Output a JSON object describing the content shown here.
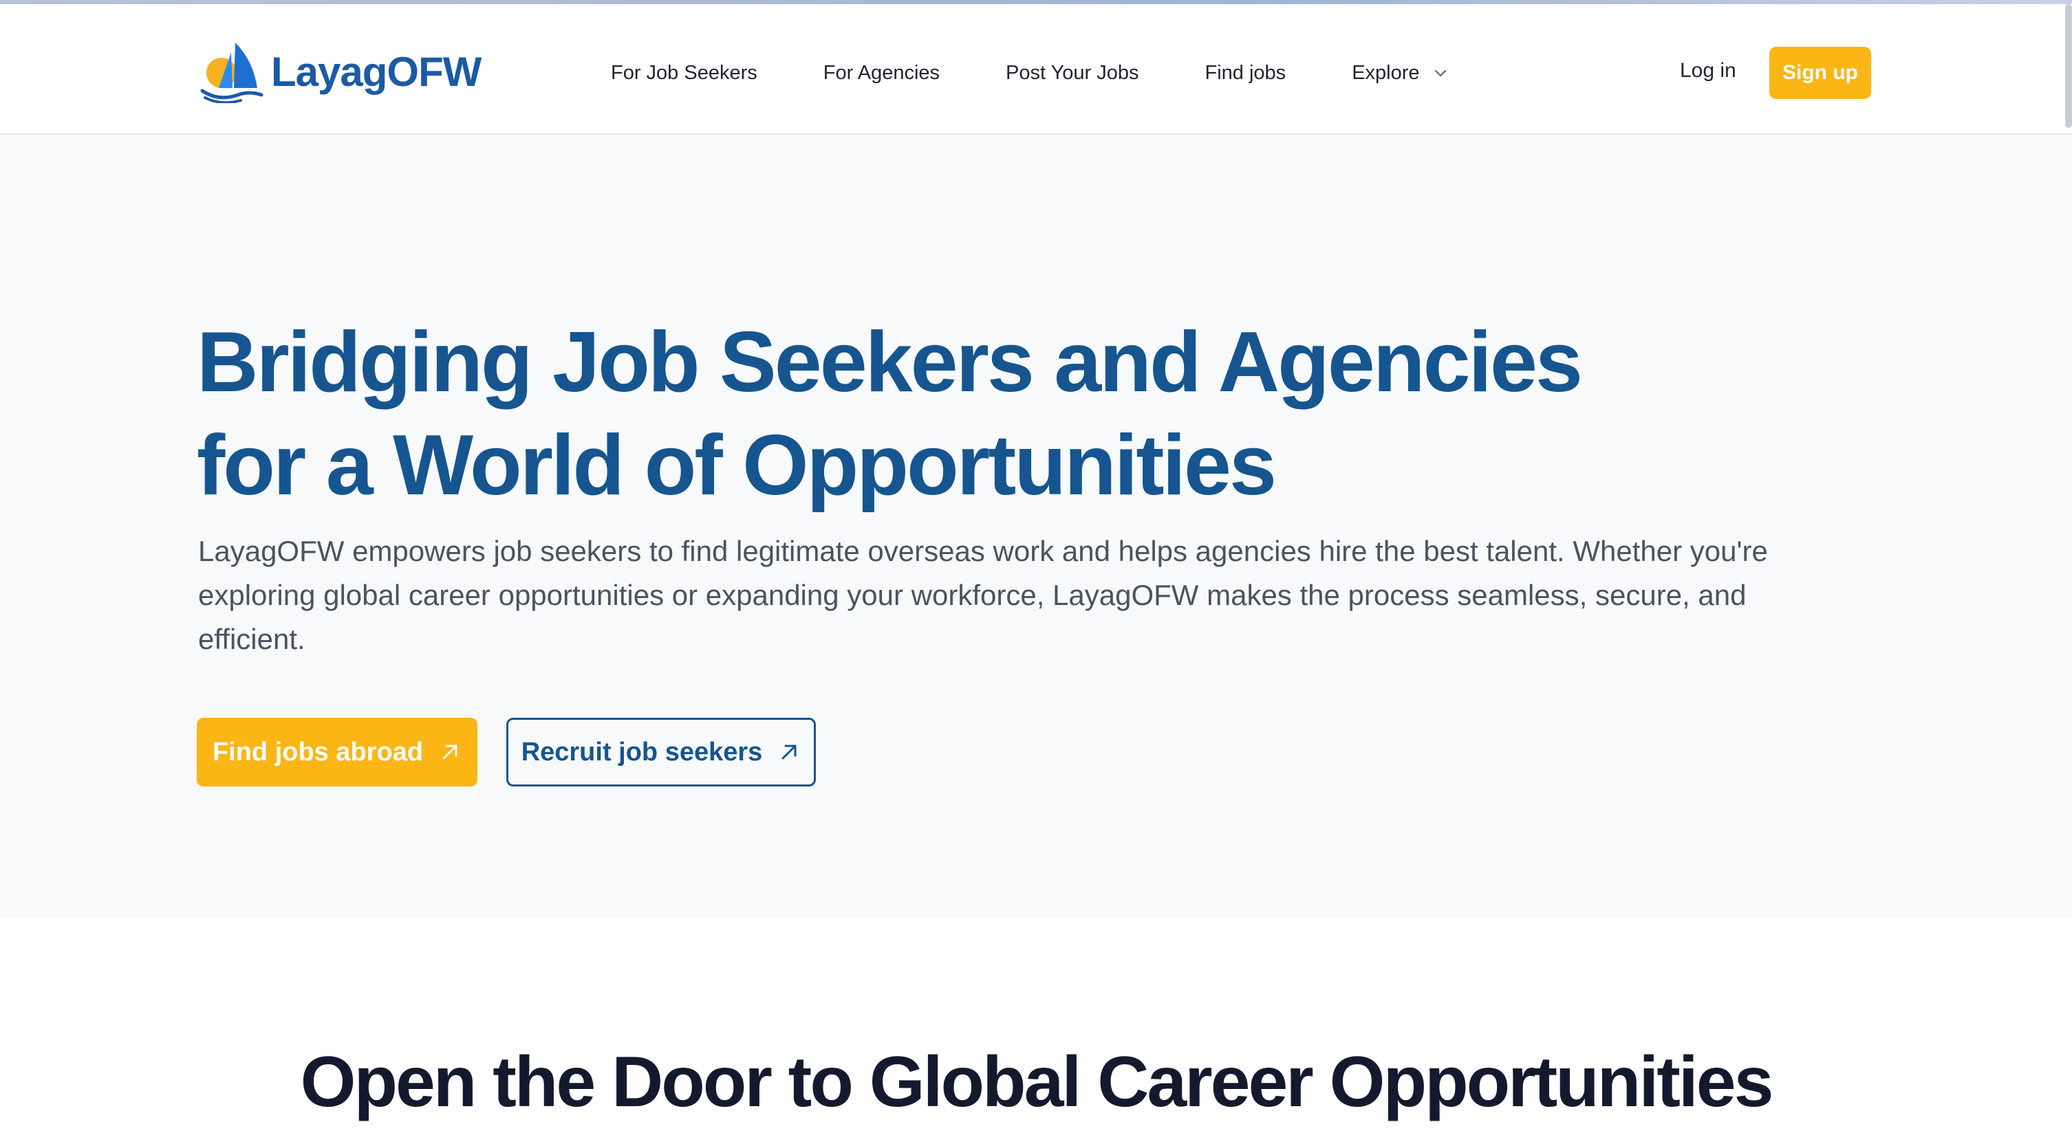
{
  "brand": {
    "name": "LayagOFW",
    "primary_color": "#1a5aa6",
    "accent_color": "#fbb515"
  },
  "nav": {
    "items": [
      {
        "label": "For Job Seekers"
      },
      {
        "label": "For Agencies"
      },
      {
        "label": "Post Your Jobs"
      },
      {
        "label": "Find jobs"
      },
      {
        "label": "Explore",
        "icon": "chevron-down-icon"
      }
    ],
    "login_label": "Log in",
    "signup_label": "Sign up"
  },
  "hero": {
    "title_line1": "Bridging Job Seekers and Agencies",
    "title_line2": "for a World of Opportunities",
    "description": "LayagOFW empowers job seekers to find legitimate overseas work and helps agencies hire the best talent. Whether you're exploring global career opportunities or expanding your workforce, LayagOFW makes the process seamless, secure, and efficient.",
    "primary_cta": {
      "label": "Find jobs abroad",
      "icon": "arrow-up-right-icon"
    },
    "secondary_cta": {
      "label": "Recruit job seekers",
      "icon": "arrow-up-right-icon"
    }
  },
  "section_two": {
    "title": "Open the Door to Global Career Opportunities"
  }
}
